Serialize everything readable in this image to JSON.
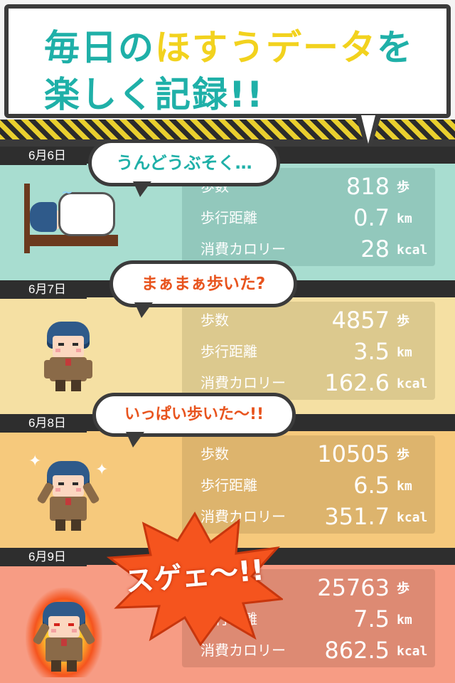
{
  "banner": {
    "line1_part1": "毎日の",
    "line1_highlight": "ほすうデータ",
    "line1_part2": "を",
    "line2": "楽しく記録!!",
    "colors": {
      "main": "#1fb0a8",
      "highlight": "#f2d21e"
    }
  },
  "labels": {
    "steps": "歩数",
    "distance": "歩行距離",
    "calories": "消費カロリー"
  },
  "units": {
    "steps": "歩",
    "distance": "km",
    "calories": "kcal"
  },
  "days": [
    {
      "date": "6月6日",
      "bubble": "うんどうぶそく…",
      "steps": "818",
      "distance": "0.7",
      "calories": "28",
      "panel_color": "#a8ddd0",
      "stats_color": "#92c8bc",
      "pose": "sleeping",
      "icon": "sleeping-character-icon"
    },
    {
      "date": "6月7日",
      "bubble": "まぁまぁ歩いた?",
      "steps": "4857",
      "distance": "3.5",
      "calories": "162.6",
      "panel_color": "#f5e0a3",
      "stats_color": "#dcc98e",
      "pose": "standing",
      "icon": "standing-character-icon"
    },
    {
      "date": "6月8日",
      "bubble": "いっぱい歩いた〜!!",
      "steps": "10505",
      "distance": "6.5",
      "calories": "351.7",
      "panel_color": "#f6c97c",
      "stats_color": "#ddb46d",
      "pose": "cheering",
      "icon": "cheering-character-icon"
    },
    {
      "date": "6月9日",
      "bubble": "スゲェ〜!!",
      "steps": "25763",
      "distance": "7.5",
      "calories": "862.5",
      "panel_color": "#f79c84",
      "stats_color": "#dd8a73",
      "pose": "fired-up",
      "icon": "flaming-character-icon"
    }
  ],
  "colors": {
    "dark": "#2e2e2e",
    "burst": "#f5541e",
    "bubble_text": "#1fb0a8",
    "bubble_text_warm": "#e8541e"
  }
}
